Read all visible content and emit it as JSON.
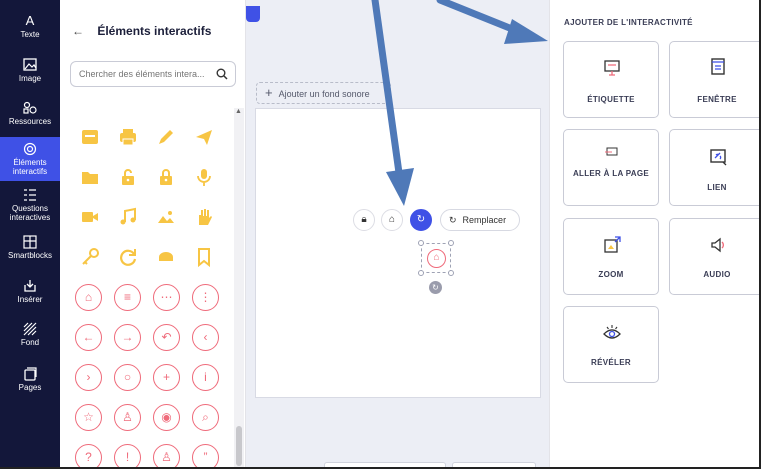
{
  "rail": {
    "items": [
      {
        "label": "Texte",
        "icon": "text-icon"
      },
      {
        "label": "Image",
        "icon": "image-icon"
      },
      {
        "label": "Ressources",
        "icon": "resources-icon"
      },
      {
        "label": "Éléments interactifs",
        "icon": "touch-icon",
        "active": true
      },
      {
        "label": "Questions interactives",
        "icon": "questions-icon"
      },
      {
        "label": "Smartblocks",
        "icon": "smartblocks-icon"
      },
      {
        "label": "Insérer",
        "icon": "insert-icon"
      },
      {
        "label": "Fond",
        "icon": "background-icon"
      },
      {
        "label": "Pages",
        "icon": "pages-icon"
      }
    ]
  },
  "elements_panel": {
    "back": "←",
    "title": "Éléments interactifs",
    "search_placeholder": "Chercher des éléments intera...",
    "icon_color": "#f7c544",
    "circle_color": "#ef6b7b"
  },
  "canvas": {
    "add_sound": "Ajouter un fond sonore",
    "add_sound_plus": "+",
    "replace": "Remplacer"
  },
  "interactivity": {
    "title": "AJOUTER DE L'INTERACTIVITÉ",
    "cards": [
      {
        "label": "ÉTIQUETTE",
        "icon": "label-icon"
      },
      {
        "label": "FENÊTRE",
        "icon": "window-icon"
      },
      {
        "label": "ALLER À LA PAGE",
        "icon": "goto-page-icon"
      },
      {
        "label": "LIEN",
        "icon": "link-icon"
      },
      {
        "label": "ZOOM",
        "icon": "zoom-icon"
      },
      {
        "label": "AUDIO",
        "icon": "audio-icon"
      },
      {
        "label": "RÉVÉLER",
        "icon": "reveal-icon"
      }
    ]
  },
  "colors": {
    "rail": "#13173a",
    "accent": "#3f51e6",
    "arrow": "#4f79b8"
  }
}
